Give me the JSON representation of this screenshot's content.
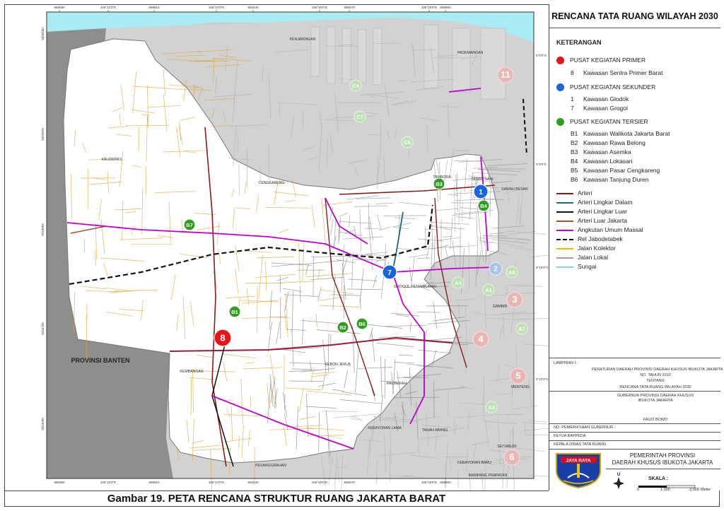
{
  "sidebar": {
    "title": "RENCANA TATA RUANG WILAYAH 2030",
    "keterangan": "KETERANGAN",
    "primer": {
      "label": "PUSAT KEGIATAN PRIMER",
      "color": "#e8141c",
      "items": [
        {
          "num": "8",
          "name": "Kawasan Sentra Primer Barat"
        }
      ]
    },
    "sekunder": {
      "label": "PUSAT KEGIATAN SEKUNDER",
      "color": "#1565e0",
      "items": [
        {
          "num": "1",
          "name": "Kawasan Glodok"
        },
        {
          "num": "7",
          "name": "Kawasan Grogol"
        }
      ]
    },
    "tersier": {
      "label": "PUSAT KEGIATAN TERSIER",
      "color": "#2e9e1f",
      "items": [
        {
          "num": "B1",
          "name": "Kawasan Walikota Jakarta Barat"
        },
        {
          "num": "B2",
          "name": "Kawasan Rawa Belong"
        },
        {
          "num": "B3",
          "name": "Kawasan Asemka"
        },
        {
          "num": "B4",
          "name": "Kawasan Lokasari"
        },
        {
          "num": "B5",
          "name": "Kawasan Pasar Cengkareng"
        },
        {
          "num": "B6",
          "name": "Kawasan Tanjung Duren"
        }
      ]
    },
    "lines": [
      {
        "label": "Arteri",
        "color": "#8b1a1a",
        "style": "solid"
      },
      {
        "label": "Arteri Lingkar Dalam",
        "color": "#1a6b6b",
        "style": "solid"
      },
      {
        "label": "Arteri Lingkar Luar",
        "color": "#111111",
        "style": "solid"
      },
      {
        "label": "Arteri Luar Jakarta",
        "color": "#a0522d",
        "style": "solid"
      },
      {
        "label": "Angkutan Umum Massal",
        "color": "#c000d0",
        "style": "solid"
      },
      {
        "label": "Rel Jabodetabek",
        "color": "#111111",
        "style": "dashed"
      },
      {
        "label": "Jalan Kolektor",
        "color": "#f0b400",
        "style": "solid"
      },
      {
        "label": "Jalan Lokal",
        "color": "#9e9e9e",
        "style": "solid"
      },
      {
        "label": "Sungai",
        "color": "#88ccee",
        "style": "solid"
      }
    ],
    "lampiran": "LAMPIRAN I :",
    "peraturan": "PERATURAN DAERAH PROVINSI DAERAH KHUSUS IBUKOTA JAKARTA",
    "nomor": "NO. TAHUN 2010",
    "tentang": "TENTANG",
    "rtrw": "RENCANA TATA RUANG WILAYAH 2030",
    "gubernur": "GUBERNUR PROVINSI DAERAH KHUSUS",
    "ibukota": "IBUKOTA JAKARTA",
    "fauzi": "FAUZI BOWO",
    "pemeriksaan": "NO. PEMERIKSAAN GUBERNUR",
    "bappeda": "KETUA BAPPEDA",
    "dinas": "KEPALA DINAS TATA RUANG",
    "pemprov_1": "PEMERINTAH PROVINSI",
    "pemprov_2": "DAERAH KHUSUS IBUKOTA JAKARTA",
    "logo_text": "JAYA RAYA",
    "north": "U",
    "skala": "SKALA :",
    "scale_ticks": [
      "0",
      "1.000",
      "2.000"
    ],
    "scale_unit": "Meter"
  },
  "map": {
    "title": "Gambar 19. PETA RENCANA STRUKTUR RUANG JAKARTA BARAT",
    "region_label": "PROVINSI BANTEN",
    "area_labels": [
      "PENJARINGAN",
      "PADEMANGAN",
      "KALIDERES",
      "CENGKARENG",
      "TAMBORA",
      "TAMAN SARI",
      "SAWAH BESAR",
      "GROGOL PETAMBURAN",
      "GAMBIR",
      "KEMBANGAN",
      "KEBON JERUK",
      "PALMERAH",
      "MENTENG",
      "KEBAYORAN LAMA",
      "TANAH ABANG",
      "SETIABUDI",
      "KEBAYORAN BARU",
      "PESANGGRAHAN",
      "MAMPANG PRAPATAN"
    ],
    "markers": [
      {
        "id": "8",
        "kind": "primer"
      },
      {
        "id": "1",
        "kind": "sekunder"
      },
      {
        "id": "7",
        "kind": "sekunder"
      },
      {
        "id": "B1",
        "kind": "tersier"
      },
      {
        "id": "B2",
        "kind": "tersier"
      },
      {
        "id": "B3",
        "kind": "tersier"
      },
      {
        "id": "B4",
        "kind": "tersier"
      },
      {
        "id": "B6",
        "kind": "tersier"
      },
      {
        "id": "B7",
        "kind": "tersier"
      },
      {
        "id": "11",
        "kind": "faded-primer"
      },
      {
        "id": "3",
        "kind": "faded-primer"
      },
      {
        "id": "4",
        "kind": "faded-primer"
      },
      {
        "id": "5",
        "kind": "faded-primer"
      },
      {
        "id": "6",
        "kind": "faded-primer"
      },
      {
        "id": "2",
        "kind": "faded-sekunder"
      },
      {
        "id": "C4",
        "kind": "faded-tersier"
      },
      {
        "id": "C7",
        "kind": "faded-tersier"
      },
      {
        "id": "C6",
        "kind": "faded-tersier"
      },
      {
        "id": "A1",
        "kind": "faded-tersier"
      },
      {
        "id": "A3",
        "kind": "faded-tersier"
      },
      {
        "id": "A4",
        "kind": "faded-tersier"
      },
      {
        "id": "A5",
        "kind": "faded-tersier"
      },
      {
        "id": "A7",
        "kind": "faded-tersier"
      }
    ],
    "top_ticks": [
      "686590",
      "106°42'0\"E",
      "689910",
      "106°44'0\"E",
      "693240",
      "106°46'0\"E",
      "696570",
      "106°48'0\"E",
      "699900"
    ],
    "bottom_ticks": [
      "686590",
      "106°42'0\"E",
      "689910",
      "106°44'0\"E",
      "693240",
      "106°46'0\"E",
      "696570",
      "106°48'0\"E",
      "699900"
    ],
    "right_ticks": [
      "6°6'0\"S",
      "6°8'0\"S",
      "6°10'0\"S",
      "6°12'0\"S"
    ],
    "left_ticks": [
      "9326100",
      "9322970",
      "9319850",
      "9316720",
      "9313590"
    ]
  }
}
